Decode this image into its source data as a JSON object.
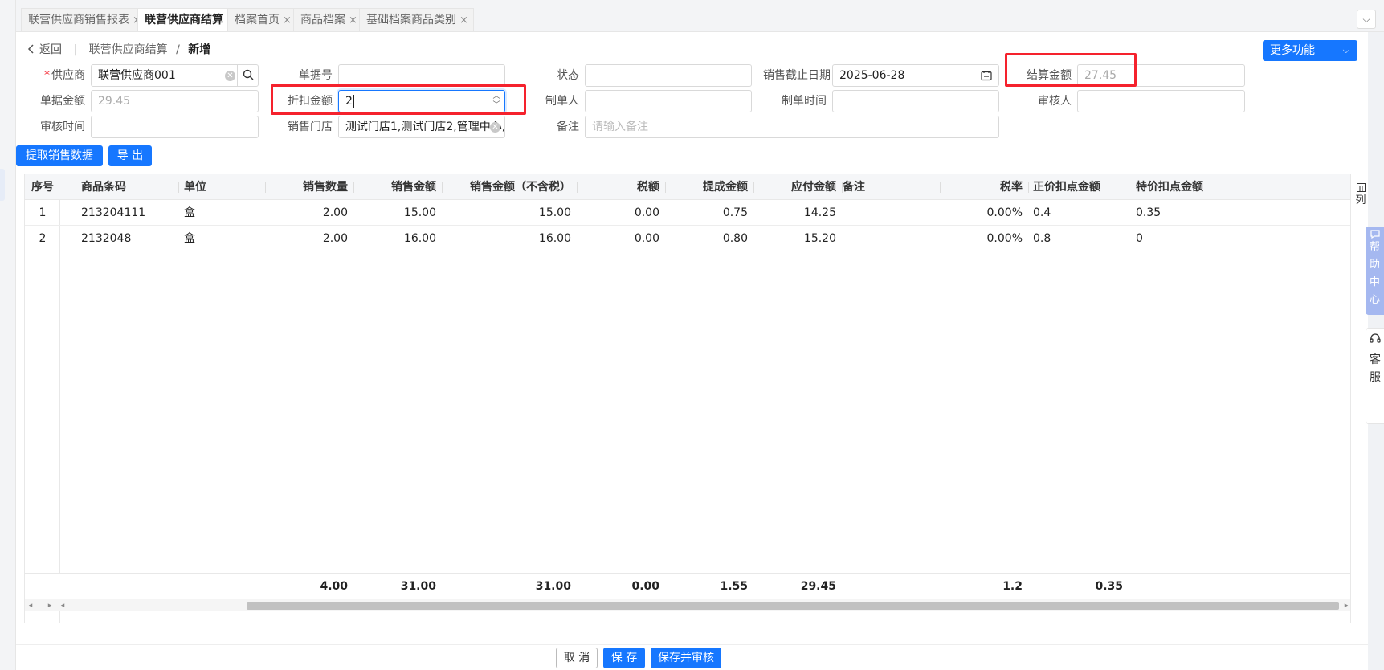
{
  "tabs": [
    {
      "label": "联营供应商销售报表",
      "active": false
    },
    {
      "label": "联营供应商结算",
      "active": true
    },
    {
      "label": "档案首页",
      "active": false
    },
    {
      "label": "商品档案",
      "active": false
    },
    {
      "label": "基础档案商品类别",
      "active": false
    }
  ],
  "tab_close_glyph": "×",
  "tab_expand_glyph": "⌵",
  "breadcrumb": {
    "back": "返回",
    "parent": "联营供应商结算",
    "separator": "/",
    "current": "新增"
  },
  "more_button": {
    "label": "更多功能",
    "chevron": "⌵"
  },
  "form": {
    "supplier": {
      "label": "供应商",
      "required_mark": "*",
      "value": "联营供应商001"
    },
    "doc_no": {
      "label": "单据号",
      "value": ""
    },
    "status": {
      "label": "状态",
      "value": ""
    },
    "sale_end_date": {
      "label": "销售截止日期",
      "value": "2025-06-28"
    },
    "settle_amount": {
      "label": "结算金额",
      "value": "27.45"
    },
    "doc_amount": {
      "label": "单据金额",
      "value": "29.45"
    },
    "discount_amount": {
      "label": "折扣金额",
      "value": "2"
    },
    "creator": {
      "label": "制单人",
      "value": ""
    },
    "create_time": {
      "label": "制单时间",
      "value": ""
    },
    "auditor": {
      "label": "审核人",
      "value": ""
    },
    "audit_time": {
      "label": "审核时间",
      "value": ""
    },
    "stores": {
      "label": "销售门店",
      "value": "测试门店1,测试门店2,管理中心,"
    },
    "remark": {
      "label": "备注",
      "placeholder": "请输入备注"
    }
  },
  "actions": {
    "fetch_sales": "提取销售数据",
    "export": "导 出"
  },
  "table": {
    "headers": {
      "seq": "序号",
      "barcode": "商品条码",
      "unit": "单位",
      "qty": "销售数量",
      "amount": "销售金额",
      "amount_ex_tax": "销售金额（不含税）",
      "tax": "税额",
      "commission": "提成金额",
      "payable": "应付金额",
      "remark": "备注",
      "tax_rate": "税率",
      "regular_deduct": "正价扣点金额",
      "special_deduct": "特价扣点金额"
    },
    "rows": [
      {
        "seq": "1",
        "barcode": "213204111",
        "unit": "盒",
        "qty": "2.00",
        "amount": "15.00",
        "amount_ex_tax": "15.00",
        "tax": "0.00",
        "commission": "0.75",
        "payable": "14.25",
        "remark": "",
        "tax_rate": "0.00%",
        "regular_deduct": "0.4",
        "special_deduct": "0.35"
      },
      {
        "seq": "2",
        "barcode": "2132048",
        "unit": "盒",
        "qty": "2.00",
        "amount": "16.00",
        "amount_ex_tax": "16.00",
        "tax": "0.00",
        "commission": "0.80",
        "payable": "15.20",
        "remark": "",
        "tax_rate": "0.00%",
        "regular_deduct": "0.8",
        "special_deduct": "0"
      }
    ],
    "totals": {
      "qty": "4.00",
      "amount": "31.00",
      "amount_ex_tax": "31.00",
      "tax": "0.00",
      "commission": "1.55",
      "payable": "29.45",
      "regular_deduct": "1.2",
      "special_deduct": "0.35"
    },
    "column_toggle_label": "列"
  },
  "side_widgets": {
    "help": [
      "帮",
      "助",
      "中",
      "心"
    ],
    "service": [
      "客",
      "服"
    ]
  },
  "bottom": {
    "cancel": "取 消",
    "save": "保 存",
    "save_audit": "保存并审核"
  },
  "icons": {
    "back": "chevron-left-icon",
    "search": "search-icon",
    "calendar": "calendar-icon",
    "clear": "clear-icon",
    "help": "message-icon",
    "service": "headset-icon",
    "columns": "columns-icon"
  },
  "colors": {
    "primary": "#1677ff",
    "highlight": "#f5222d",
    "help_widget": "#a5b8f0"
  }
}
